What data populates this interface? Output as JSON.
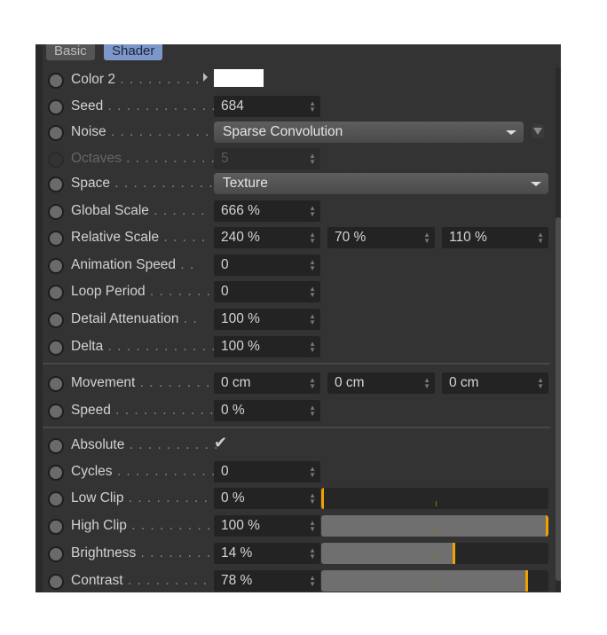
{
  "tabs": [
    {
      "label": "Basic",
      "active": false
    },
    {
      "label": "Shader",
      "active": true
    }
  ],
  "rows": {
    "color2": {
      "label": "Color 2",
      "dots": " . . . . . . . . .",
      "value_color": "#ffffff"
    },
    "seed": {
      "label": "Seed",
      "dots": " . . . . . . . . . . . .",
      "value": "684"
    },
    "noise": {
      "label": "Noise",
      "dots": " . . . . . . . . . . . .",
      "value": "Sparse Convolution"
    },
    "octaves": {
      "label": "Octaves",
      "dots": " . . . . . . . . . .",
      "value": "5",
      "disabled": true
    },
    "space": {
      "label": "Space",
      "dots": " . . . . . . . . . . . .",
      "value": "Texture"
    },
    "global_scale": {
      "label": "Global Scale",
      "dots": " . . . . . .",
      "value": "666 %"
    },
    "relative_scale": {
      "label": "Relative Scale",
      "dots": " . . . . .",
      "values": [
        "240 %",
        "70 %",
        "110 %"
      ]
    },
    "animation_speed": {
      "label": "Animation Speed",
      "dots": " . .",
      "value": "0"
    },
    "loop_period": {
      "label": "Loop Period",
      "dots": " . . . . . . .",
      "value": "0"
    },
    "detail_attenuation": {
      "label": "Detail Attenuation",
      "dots": " . .",
      "value": "100 %"
    },
    "delta": {
      "label": "Delta",
      "dots": " . . . . . . . . . . . .",
      "value": "100 %"
    },
    "movement": {
      "label": "Movement",
      "dots": " . . . . . . . .",
      "values": [
        "0 cm",
        "0 cm",
        "0 cm"
      ]
    },
    "speed": {
      "label": "Speed",
      "dots": " . . . . . . . . . . . .",
      "value": "0 %"
    },
    "absolute": {
      "label": "Absolute",
      "dots": " . . . . . . . . . .",
      "checked": true,
      "check": "✔"
    },
    "cycles": {
      "label": "Cycles",
      "dots": " . . . . . . . . . . .",
      "value": "0"
    },
    "low_clip": {
      "label": "Low Clip",
      "dots": " . . . . . . . . . .",
      "value": "0 %",
      "slider": 0.0
    },
    "high_clip": {
      "label": "High Clip",
      "dots": " . . . . . . . . .",
      "value": "100 %",
      "slider": 1.0
    },
    "brightness": {
      "label": "Brightness",
      "dots": " . . . . . . . .",
      "value": "14 %",
      "slider": 0.58
    },
    "contrast": {
      "label": "Contrast",
      "dots": " . . . . . . . . . .",
      "value": "78 %",
      "slider": 0.9
    }
  },
  "accent": "#f0a000",
  "spin_glyph": "▲▼"
}
